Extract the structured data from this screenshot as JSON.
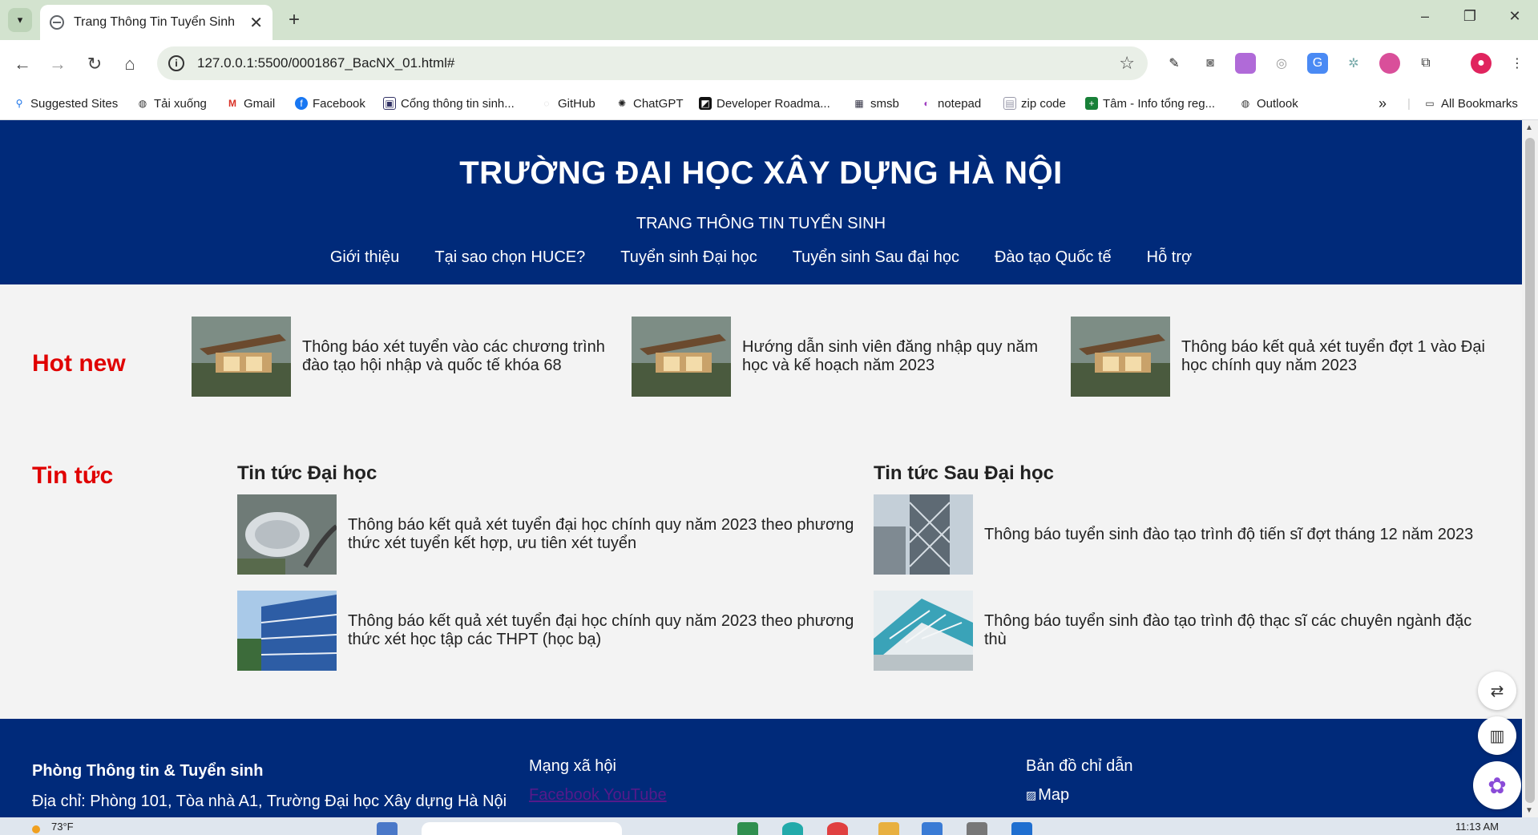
{
  "browser": {
    "tab_title": "Trang Thông Tin Tuyển Sinh",
    "url": "127.0.0.1:5500/0001867_BacNX_01.html#",
    "bookmarks": [
      {
        "label": "Suggested Sites",
        "icon": "search-icon"
      },
      {
        "label": "Tải xuống",
        "icon": "globe-icon"
      },
      {
        "label": "Gmail",
        "icon": "gmail-icon"
      },
      {
        "label": "Facebook",
        "icon": "facebook-icon"
      },
      {
        "label": "Cổng thông tin sinh...",
        "icon": "portal-icon"
      },
      {
        "label": "GitHub",
        "icon": "github-icon"
      },
      {
        "label": "ChatGPT",
        "icon": "chatgpt-icon"
      },
      {
        "label": "Developer Roadma...",
        "icon": "roadmap-icon"
      },
      {
        "label": "smsb",
        "icon": "bank-icon"
      },
      {
        "label": "notepad",
        "icon": "notepad-icon"
      },
      {
        "label": "zip code",
        "icon": "file-icon"
      },
      {
        "label": "Tâm - Info tổng reg...",
        "icon": "sheets-icon"
      },
      {
        "label": "Outlook",
        "icon": "globe-icon"
      }
    ],
    "all_bookmarks": "All Bookmarks",
    "more": "»"
  },
  "header": {
    "title": "TRƯỜNG ĐẠI HỌC XÂY DỰNG HÀ NỘI",
    "subtitle": "TRANG THÔNG TIN TUYỂN SINH",
    "nav": [
      "Giới thiệu",
      "Tại sao chọn HUCE?",
      "Tuyển sinh Đại học",
      "Tuyển sinh Sau đại học",
      "Đào tạo Quốc tế",
      "Hỗ trợ"
    ]
  },
  "hot_new": {
    "label": "Hot new",
    "items": [
      {
        "line1": "Thông báo xét tuyển vào các chương trình",
        "line2": "đào tạo hội nhập và quốc tế khóa 68"
      },
      {
        "line1": "Hướng dẫn sinh viên đăng nhập quy năm",
        "line2": "học và kế hoạch năm 2023"
      },
      {
        "line1": "Thông báo kết quả xét tuyển đợt 1 vào Đại",
        "line2": "học chính quy năm 2023"
      }
    ]
  },
  "news": {
    "label": "Tin tức",
    "undergrad": {
      "title": "Tin tức Đại học",
      "items": [
        {
          "line1": "Thông báo kết quả xét tuyển đại học chính quy năm 2023 theo phương",
          "line2": "thức xét tuyển kết hợp, ưu tiên xét tuyển"
        },
        {
          "line1": "Thông báo kết quả xét tuyển đại học chính quy năm 2023 theo phương",
          "line2": "thức xét học tập các THPT (học bạ)"
        }
      ]
    },
    "postgrad": {
      "title": "Tin tức Sau Đại học",
      "items": [
        {
          "line1": "Thông báo tuyển sinh đào tạo trình độ tiến sĩ đợt tháng 12 năm 2023",
          "line2": ""
        },
        {
          "line1": "Thông báo tuyển sinh đào tạo trình độ thạc sĩ các chuyên ngành đặc",
          "line2": "thù"
        }
      ]
    }
  },
  "footer": {
    "office_title": "Phòng Thông tin & Tuyển sinh",
    "office_address": "Địa chỉ: Phòng 101, Tòa nhà A1, Trường Đại học Xây dựng Hà Nội",
    "social_title": "Mạng xã hội",
    "social_links": "Facebook YouTube",
    "map_title": "Bản đồ chỉ dẫn",
    "map_alt": "Map"
  },
  "taskbar": {
    "weather": "73°F",
    "time": "11:13 AM"
  },
  "colors": {
    "header_bg": "#002a7a",
    "accent_red": "#e00000",
    "page_bg": "#f3f3f3"
  }
}
